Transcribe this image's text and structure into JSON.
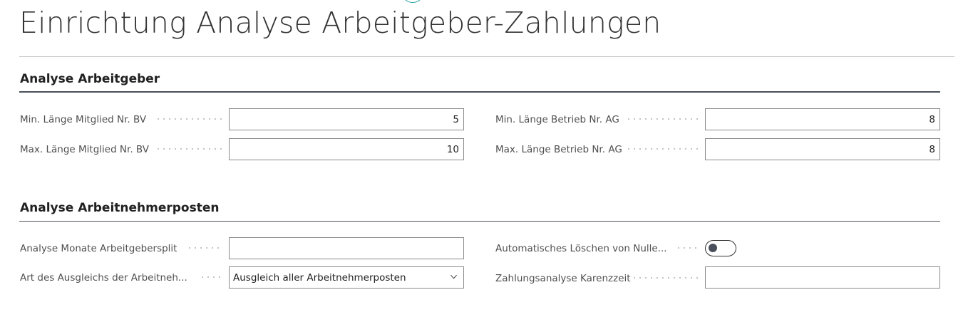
{
  "page": {
    "title": "Einrichtung Analyse Arbeitgeber-Zahlungen"
  },
  "section1": {
    "header": "Analyse Arbeitgeber",
    "fields": [
      {
        "label": "Min. Länge Mitglied Nr. BV",
        "value": "5"
      },
      {
        "label": "Max. Länge Mitglied Nr. BV",
        "value": "10"
      },
      {
        "label": "Min. Länge Betrieb Nr. AG",
        "value": "8"
      },
      {
        "label": "Max. Länge Betrieb Nr. AG",
        "value": "8"
      }
    ]
  },
  "section2": {
    "header": "Analyse Arbeitnehmerposten",
    "fields": [
      {
        "label": "Analyse Monate Arbeitgebersplit",
        "value": ""
      },
      {
        "label": "Art des Ausgleichs der Arbeitneh...",
        "value": "Ausgleich aller Arbeitnehmerposten"
      },
      {
        "label": "Automatisches Löschen von Nulle...",
        "value": false
      },
      {
        "label": "Zahlungsanalyse Karenzzeit",
        "value": ""
      }
    ]
  },
  "colors": {
    "section_rule": "#4a4f5c",
    "field_border": "#8a8a8a",
    "accent_ring": "#2aa3a3"
  },
  "icons": {
    "dropdown": "chevron-down-icon",
    "toggle": "toggle-switch"
  }
}
